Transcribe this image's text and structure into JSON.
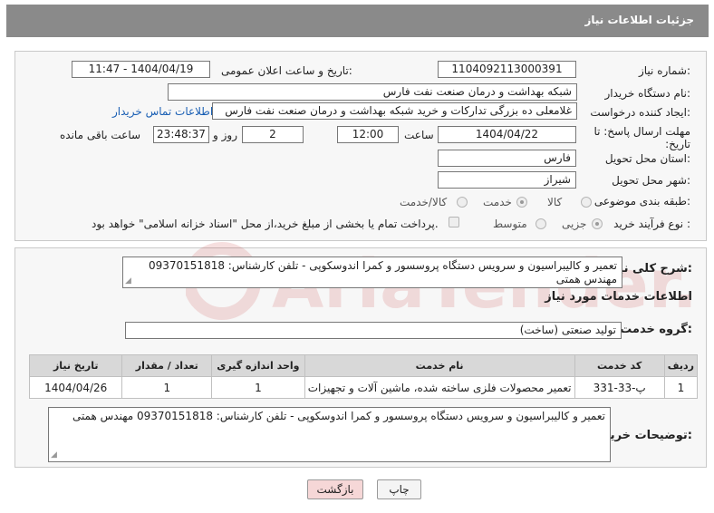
{
  "header": {
    "title": "جزئیات اطلاعات نیاز"
  },
  "form": {
    "need_number_label": "شماره نیاز:",
    "need_number": "1104092113000391",
    "announce_label": "تاریخ و ساعت اعلان عمومی:",
    "announce_value": "1404/04/19 - 11:47",
    "buyer_org_label": "نام دستگاه خریدار:",
    "buyer_org": "شبکه بهداشت و درمان صنعت نفت فارس",
    "requester_label": "ایجاد کننده درخواست:",
    "requester": "غلامعلی ده بزرگی تدارکات و خرید شبکه بهداشت و درمان صنعت نفت فارس",
    "contact_link": "اطلاعات تماس خریدار",
    "deadline_label": "مهلت ارسال پاسخ: تا تاریخ:",
    "deadline_date": "1404/04/22",
    "time_label": "ساعت",
    "deadline_time": "12:00",
    "days_value": "2",
    "days_label": "روز و",
    "remaining_time": "23:48:37",
    "remaining_label": "ساعت باقی مانده",
    "province_label": "استان محل تحویل:",
    "province": "فارس",
    "city_label": "شهر محل تحویل:",
    "city": "شیراز",
    "category_label": "طبقه بندی موضوعی:",
    "category_options": [
      "کالا",
      "خدمت",
      "کالا/خدمت"
    ],
    "category_selected": "خدمت",
    "process_label": "نوع فرآیند خرید :",
    "process_options": [
      "جزیی",
      "متوسط"
    ],
    "process_selected": "جزیی",
    "payment_note": "پرداخت تمام یا بخشی از مبلغ خرید،از محل \"اسناد خزانه اسلامی\" خواهد بود."
  },
  "details": {
    "summary_label": "شرح کلی نیاز:",
    "summary": "تعمیر و کالیبراسیون و سرویس دستگاه پروسسور و کمرا اندوسکوپی - تلفن کارشناس: 09370151818 مهندس همتی",
    "services_heading": "اطلاعات خدمات مورد نیاز",
    "service_group_label": "گروه خدمت:",
    "service_group": "تولید صنعتی (ساخت)",
    "table": {
      "headers": [
        "ردیف",
        "کد خدمت",
        "نام خدمت",
        "واحد اندازه گیری",
        "تعداد / مقدار",
        "تاریخ نیاز"
      ],
      "rows": [
        [
          "1",
          "پ-33-331",
          "تعمیر محصولات فلزی ساخته شده، ماشین آلات و تجهیزات",
          "1",
          "1",
          "1404/04/26"
        ]
      ]
    },
    "buyer_notes_label": "توضیحات خریدار:",
    "buyer_notes": "تعمیر و کالیبراسیون و سرویس دستگاه پروسسور و کمرا اندوسکوپی - تلفن کارشناس: 09370151818 مهندس همتی"
  },
  "buttons": {
    "print": "چاپ",
    "back": "بازگشت"
  },
  "watermark": {
    "text": "AriaTender.neT"
  },
  "colors": {
    "titlebar": "#8a8a8a",
    "link": "#1a5fb4",
    "back_button": "#f6d7d7",
    "watermark": "#c62828"
  }
}
